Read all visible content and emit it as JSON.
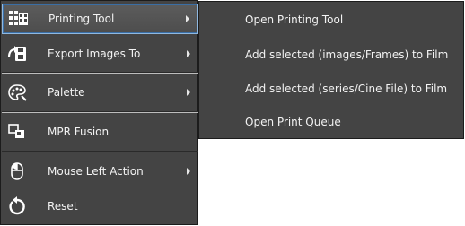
{
  "menu": {
    "items": [
      {
        "label": "Printing Tool",
        "icon": "printing-grid-icon",
        "has_submenu": true,
        "selected": true
      },
      {
        "label": "Export Images To",
        "icon": "export-images-icon",
        "has_submenu": true
      },
      {
        "label": "Palette",
        "icon": "palette-icon",
        "has_submenu": true
      },
      {
        "label": "MPR Fusion",
        "icon": "mpr-fusion-icon",
        "has_submenu": false
      },
      {
        "label": "Mouse Left Action",
        "icon": "mouse-icon",
        "has_submenu": true
      },
      {
        "label": "Reset",
        "icon": "reset-icon",
        "has_submenu": false
      }
    ]
  },
  "submenu": {
    "items": [
      {
        "label": "Open Printing Tool"
      },
      {
        "label": "Add selected (images/Frames) to Film"
      },
      {
        "label": "Add selected (series/Cine File) to Film"
      },
      {
        "label": "Open Print Queue"
      }
    ]
  },
  "colors": {
    "menu_bg": "#444444",
    "selection_border": "#8fb8e0",
    "text": "#f2f2f2"
  }
}
